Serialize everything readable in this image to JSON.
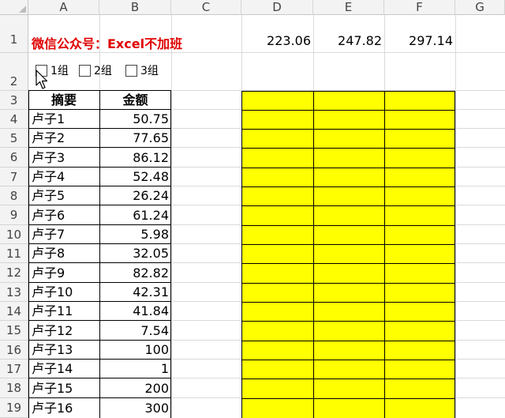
{
  "columns": [
    "A",
    "B",
    "C",
    "D",
    "E",
    "F",
    "G"
  ],
  "rows": [
    "1",
    "2",
    "3",
    "4",
    "5",
    "6",
    "7",
    "8",
    "9",
    "10",
    "11",
    "12",
    "13",
    "14",
    "15",
    "16",
    "17",
    "18",
    "19"
  ],
  "row1": {
    "title": "微信公众号：Excel不加班",
    "d": "223.06",
    "e": "247.82",
    "f": "297.14"
  },
  "checkboxes": [
    {
      "label": "1组",
      "checked": false
    },
    {
      "label": "2组",
      "checked": false
    },
    {
      "label": "3组",
      "checked": false
    }
  ],
  "table": {
    "headers": [
      "摘要",
      "金额"
    ],
    "rows": [
      [
        "卢子1",
        "50.75"
      ],
      [
        "卢子2",
        "77.65"
      ],
      [
        "卢子3",
        "86.12"
      ],
      [
        "卢子4",
        "52.48"
      ],
      [
        "卢子5",
        "26.24"
      ],
      [
        "卢子6",
        "61.24"
      ],
      [
        "卢子7",
        "5.98"
      ],
      [
        "卢子8",
        "32.05"
      ],
      [
        "卢子9",
        "82.82"
      ],
      [
        "卢子10",
        "42.31"
      ],
      [
        "卢子11",
        "41.84"
      ],
      [
        "卢子12",
        "7.54"
      ],
      [
        "卢子13",
        "100"
      ],
      [
        "卢子14",
        "1"
      ],
      [
        "卢子15",
        "200"
      ],
      [
        "卢子16",
        "300"
      ]
    ]
  },
  "colors": {
    "title": "#e00000",
    "fill": "#ffff00",
    "header_bg": "#f3f3f3"
  },
  "icons": [
    "cursor-icon"
  ]
}
